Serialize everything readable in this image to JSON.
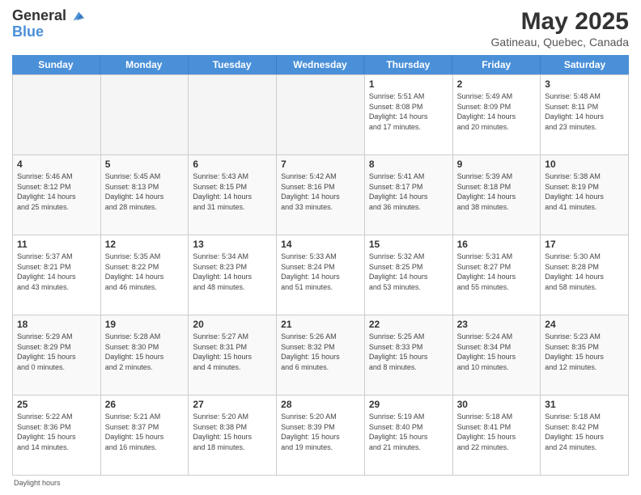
{
  "header": {
    "logo_line1": "General",
    "logo_line2": "Blue",
    "title": "May 2025",
    "subtitle": "Gatineau, Quebec, Canada"
  },
  "days_of_week": [
    "Sunday",
    "Monday",
    "Tuesday",
    "Wednesday",
    "Thursday",
    "Friday",
    "Saturday"
  ],
  "weeks": [
    [
      {
        "num": "",
        "info": "",
        "empty": true
      },
      {
        "num": "",
        "info": "",
        "empty": true
      },
      {
        "num": "",
        "info": "",
        "empty": true
      },
      {
        "num": "",
        "info": "",
        "empty": true
      },
      {
        "num": "1",
        "info": "Sunrise: 5:51 AM\nSunset: 8:08 PM\nDaylight: 14 hours\nand 17 minutes.",
        "empty": false
      },
      {
        "num": "2",
        "info": "Sunrise: 5:49 AM\nSunset: 8:09 PM\nDaylight: 14 hours\nand 20 minutes.",
        "empty": false
      },
      {
        "num": "3",
        "info": "Sunrise: 5:48 AM\nSunset: 8:11 PM\nDaylight: 14 hours\nand 23 minutes.",
        "empty": false
      }
    ],
    [
      {
        "num": "4",
        "info": "Sunrise: 5:46 AM\nSunset: 8:12 PM\nDaylight: 14 hours\nand 25 minutes.",
        "empty": false
      },
      {
        "num": "5",
        "info": "Sunrise: 5:45 AM\nSunset: 8:13 PM\nDaylight: 14 hours\nand 28 minutes.",
        "empty": false
      },
      {
        "num": "6",
        "info": "Sunrise: 5:43 AM\nSunset: 8:15 PM\nDaylight: 14 hours\nand 31 minutes.",
        "empty": false
      },
      {
        "num": "7",
        "info": "Sunrise: 5:42 AM\nSunset: 8:16 PM\nDaylight: 14 hours\nand 33 minutes.",
        "empty": false
      },
      {
        "num": "8",
        "info": "Sunrise: 5:41 AM\nSunset: 8:17 PM\nDaylight: 14 hours\nand 36 minutes.",
        "empty": false
      },
      {
        "num": "9",
        "info": "Sunrise: 5:39 AM\nSunset: 8:18 PM\nDaylight: 14 hours\nand 38 minutes.",
        "empty": false
      },
      {
        "num": "10",
        "info": "Sunrise: 5:38 AM\nSunset: 8:19 PM\nDaylight: 14 hours\nand 41 minutes.",
        "empty": false
      }
    ],
    [
      {
        "num": "11",
        "info": "Sunrise: 5:37 AM\nSunset: 8:21 PM\nDaylight: 14 hours\nand 43 minutes.",
        "empty": false
      },
      {
        "num": "12",
        "info": "Sunrise: 5:35 AM\nSunset: 8:22 PM\nDaylight: 14 hours\nand 46 minutes.",
        "empty": false
      },
      {
        "num": "13",
        "info": "Sunrise: 5:34 AM\nSunset: 8:23 PM\nDaylight: 14 hours\nand 48 minutes.",
        "empty": false
      },
      {
        "num": "14",
        "info": "Sunrise: 5:33 AM\nSunset: 8:24 PM\nDaylight: 14 hours\nand 51 minutes.",
        "empty": false
      },
      {
        "num": "15",
        "info": "Sunrise: 5:32 AM\nSunset: 8:25 PM\nDaylight: 14 hours\nand 53 minutes.",
        "empty": false
      },
      {
        "num": "16",
        "info": "Sunrise: 5:31 AM\nSunset: 8:27 PM\nDaylight: 14 hours\nand 55 minutes.",
        "empty": false
      },
      {
        "num": "17",
        "info": "Sunrise: 5:30 AM\nSunset: 8:28 PM\nDaylight: 14 hours\nand 58 minutes.",
        "empty": false
      }
    ],
    [
      {
        "num": "18",
        "info": "Sunrise: 5:29 AM\nSunset: 8:29 PM\nDaylight: 15 hours\nand 0 minutes.",
        "empty": false
      },
      {
        "num": "19",
        "info": "Sunrise: 5:28 AM\nSunset: 8:30 PM\nDaylight: 15 hours\nand 2 minutes.",
        "empty": false
      },
      {
        "num": "20",
        "info": "Sunrise: 5:27 AM\nSunset: 8:31 PM\nDaylight: 15 hours\nand 4 minutes.",
        "empty": false
      },
      {
        "num": "21",
        "info": "Sunrise: 5:26 AM\nSunset: 8:32 PM\nDaylight: 15 hours\nand 6 minutes.",
        "empty": false
      },
      {
        "num": "22",
        "info": "Sunrise: 5:25 AM\nSunset: 8:33 PM\nDaylight: 15 hours\nand 8 minutes.",
        "empty": false
      },
      {
        "num": "23",
        "info": "Sunrise: 5:24 AM\nSunset: 8:34 PM\nDaylight: 15 hours\nand 10 minutes.",
        "empty": false
      },
      {
        "num": "24",
        "info": "Sunrise: 5:23 AM\nSunset: 8:35 PM\nDaylight: 15 hours\nand 12 minutes.",
        "empty": false
      }
    ],
    [
      {
        "num": "25",
        "info": "Sunrise: 5:22 AM\nSunset: 8:36 PM\nDaylight: 15 hours\nand 14 minutes.",
        "empty": false
      },
      {
        "num": "26",
        "info": "Sunrise: 5:21 AM\nSunset: 8:37 PM\nDaylight: 15 hours\nand 16 minutes.",
        "empty": false
      },
      {
        "num": "27",
        "info": "Sunrise: 5:20 AM\nSunset: 8:38 PM\nDaylight: 15 hours\nand 18 minutes.",
        "empty": false
      },
      {
        "num": "28",
        "info": "Sunrise: 5:20 AM\nSunset: 8:39 PM\nDaylight: 15 hours\nand 19 minutes.",
        "empty": false
      },
      {
        "num": "29",
        "info": "Sunrise: 5:19 AM\nSunset: 8:40 PM\nDaylight: 15 hours\nand 21 minutes.",
        "empty": false
      },
      {
        "num": "30",
        "info": "Sunrise: 5:18 AM\nSunset: 8:41 PM\nDaylight: 15 hours\nand 22 minutes.",
        "empty": false
      },
      {
        "num": "31",
        "info": "Sunrise: 5:18 AM\nSunset: 8:42 PM\nDaylight: 15 hours\nand 24 minutes.",
        "empty": false
      }
    ]
  ],
  "footer": "Daylight hours"
}
